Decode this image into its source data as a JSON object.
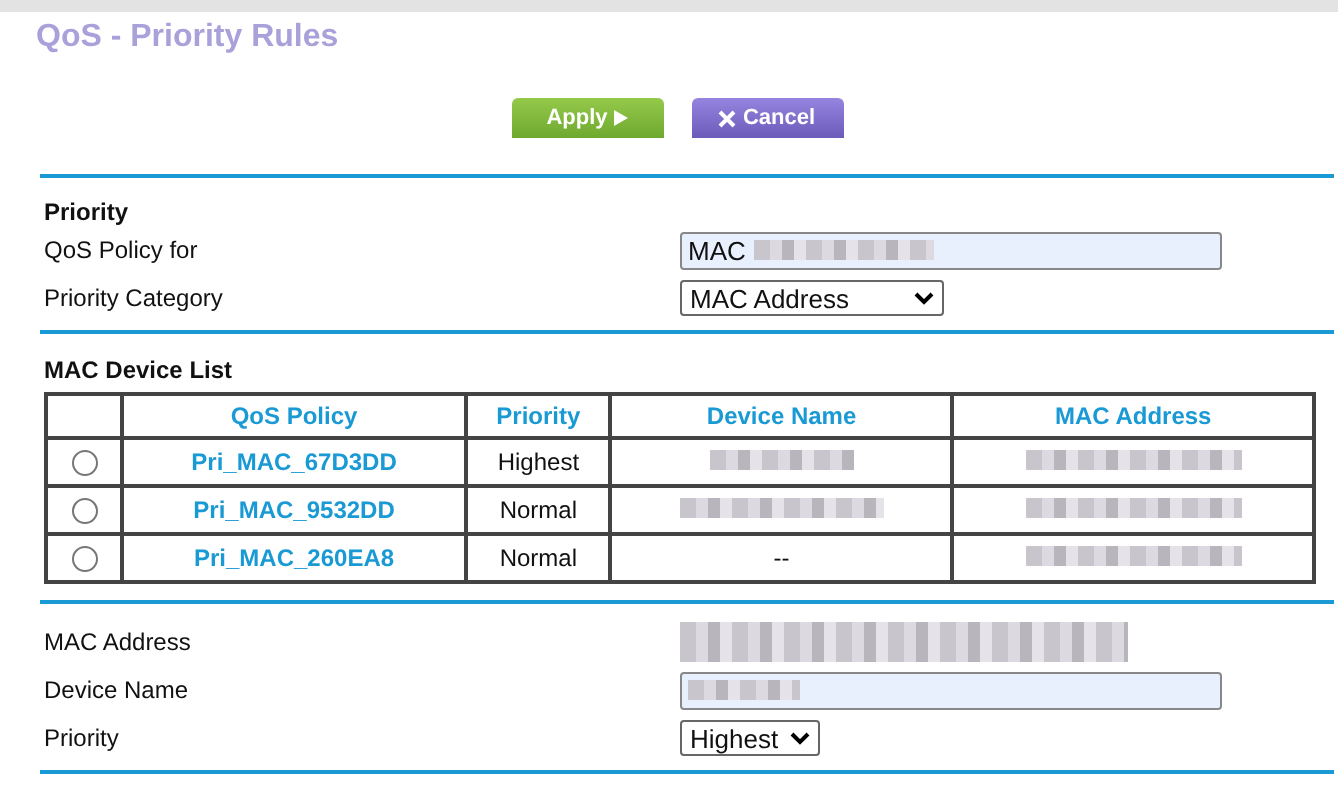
{
  "title": "QoS - Priority Rules",
  "buttons": [
    {
      "kind": "apply",
      "label": "Apply"
    },
    {
      "kind": "cancel",
      "label": "Cancel"
    }
  ],
  "priority_section": {
    "heading": "Priority",
    "fields": [
      {
        "kind": "text",
        "label": "QoS Policy for",
        "value": "MAC"
      },
      {
        "kind": "select",
        "label": "Priority Category",
        "value": "MAC Address"
      }
    ]
  },
  "device_list": {
    "heading": "MAC Device List",
    "columns": [
      "QoS Policy",
      "Priority",
      "Device Name",
      "MAC Address"
    ],
    "rows": [
      {
        "selected": false,
        "policy": "Pri_MAC_67D3DD",
        "priority": "Highest",
        "device_name": ""
      },
      {
        "selected": false,
        "policy": "Pri_MAC_9532DD",
        "priority": "Normal",
        "device_name": ""
      },
      {
        "selected": false,
        "policy": "Pri_MAC_260EA8",
        "priority": "Normal",
        "device_name": "--"
      }
    ]
  },
  "device_form": {
    "fields": [
      {
        "kind": "static",
        "label": "MAC Address"
      },
      {
        "kind": "text",
        "label": "Device Name"
      },
      {
        "kind": "select",
        "label": "Priority",
        "value": "Highest"
      }
    ]
  }
}
